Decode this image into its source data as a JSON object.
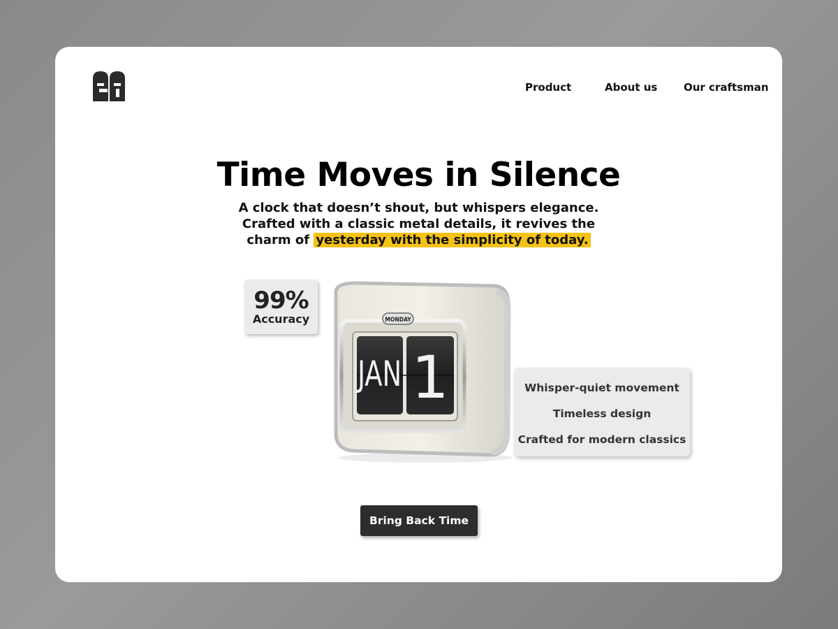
{
  "nav": {
    "items": [
      "Product",
      "About us",
      "Our craftsman"
    ]
  },
  "hero": {
    "title": "Time Moves in Silence",
    "subtitle_line1": "A clock that doesn’t shout, but whispers elegance.",
    "subtitle_line2": "Crafted with a classic metal details, it revives the",
    "subtitle_line3_prefix": "charm of ",
    "subtitle_highlight": "yesterday with the simplicity of today."
  },
  "stat": {
    "value": "99%",
    "label": "Accuracy"
  },
  "clock": {
    "day": "MONDAY",
    "month": "JAN",
    "date": "1"
  },
  "features": [
    "Whisper-quiet movement",
    "Timeless design",
    "Crafted for modern classics"
  ],
  "cta": {
    "label": "Bring Back Time"
  },
  "colors": {
    "highlight": "#f5c216",
    "button": "#2d2d2d",
    "panel": "#ebebea"
  }
}
